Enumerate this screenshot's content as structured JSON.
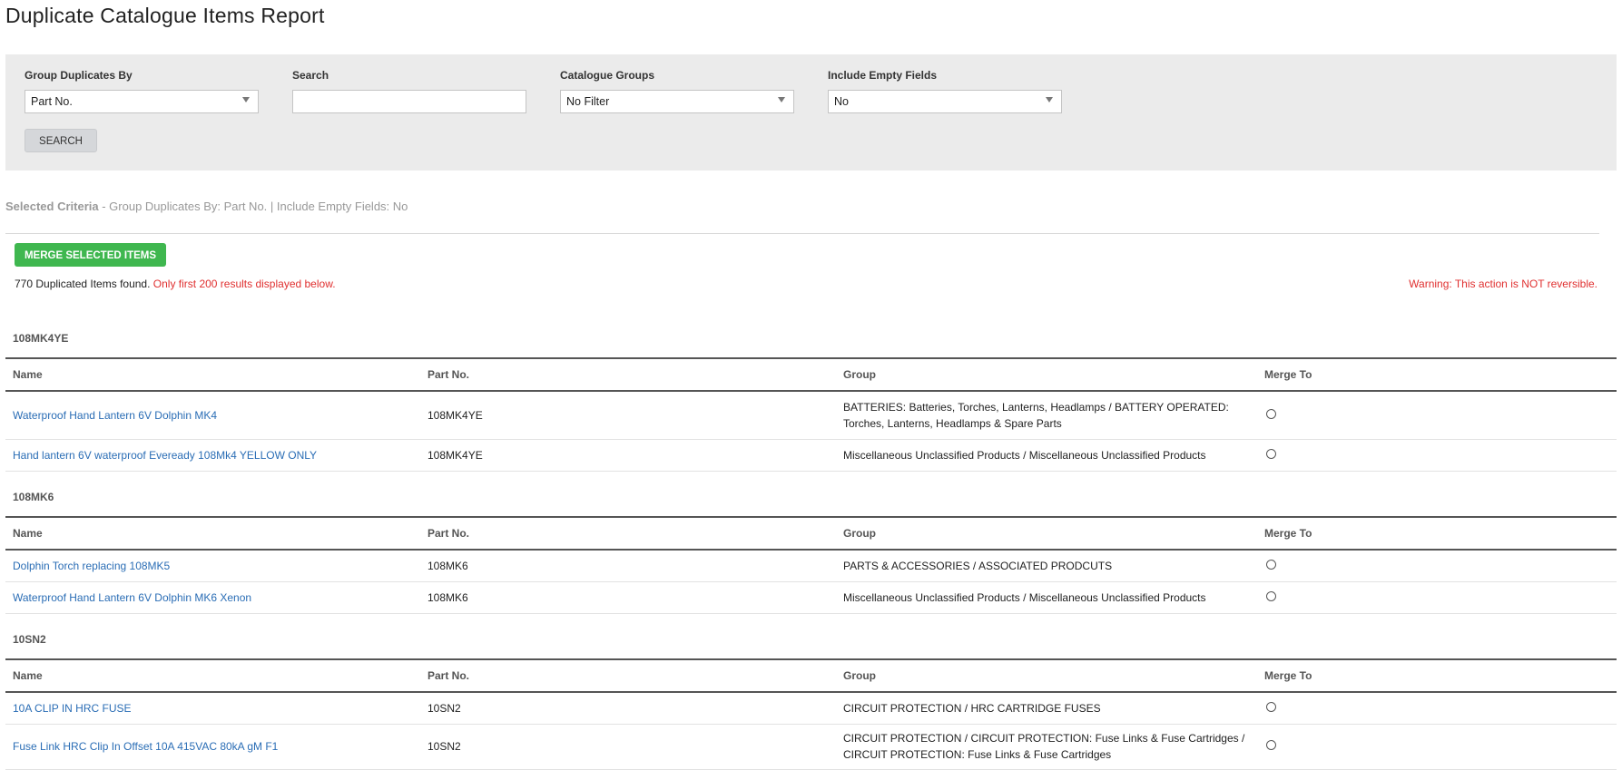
{
  "title": "Duplicate Catalogue Items Report",
  "filters": {
    "group_by": {
      "label": "Group Duplicates By",
      "value": "Part No."
    },
    "search": {
      "label": "Search",
      "value": ""
    },
    "catalogue_groups": {
      "label": "Catalogue Groups",
      "value": "No Filter"
    },
    "include_empty": {
      "label": "Include Empty Fields",
      "value": "No"
    },
    "search_button": "SEARCH"
  },
  "criteria": {
    "label": "Selected Criteria",
    "text": " - Group Duplicates By: Part No. | Include Empty Fields: No"
  },
  "merge_button": "MERGE SELECTED ITEMS",
  "results": {
    "count_text": "770 Duplicated Items found. ",
    "limit_text": "Only first 200 results displayed below.",
    "warning": "Warning: This action is NOT reversible."
  },
  "columns": {
    "name": "Name",
    "part_no": "Part No.",
    "group": "Group",
    "merge_to": "Merge To"
  },
  "groups": [
    {
      "title": "108MK4YE",
      "rows": [
        {
          "name": "Waterproof Hand Lantern 6V Dolphin MK4",
          "part_no": "108MK4YE",
          "group": "BATTERIES: Batteries, Torches, Lanterns, Headlamps / BATTERY OPERATED: Torches, Lanterns, Headlamps & Spare Parts"
        },
        {
          "name": "Hand lantern 6V waterproof Eveready 108Mk4 YELLOW ONLY",
          "part_no": "108MK4YE",
          "group": "Miscellaneous Unclassified Products / Miscellaneous Unclassified Products"
        }
      ]
    },
    {
      "title": "108MK6",
      "rows": [
        {
          "name": "Dolphin Torch replacing 108MK5",
          "part_no": "108MK6",
          "group": "PARTS & ACCESSORIES / ASSOCIATED PRODCUTS"
        },
        {
          "name": "Waterproof Hand Lantern 6V Dolphin MK6 Xenon",
          "part_no": "108MK6",
          "group": "Miscellaneous Unclassified Products / Miscellaneous Unclassified Products"
        }
      ]
    },
    {
      "title": "10SN2",
      "rows": [
        {
          "name": "10A CLIP IN HRC FUSE",
          "part_no": "10SN2",
          "group": "CIRCUIT PROTECTION / HRC CARTRIDGE FUSES"
        },
        {
          "name": "Fuse Link HRC Clip In Offset 10A 415VAC 80kA gM F1",
          "part_no": "10SN2",
          "group": "CIRCUIT PROTECTION / CIRCUIT PROTECTION: Fuse Links & Fuse Cartridges / CIRCUIT PROTECTION: Fuse Links & Fuse Cartridges"
        }
      ]
    }
  ]
}
